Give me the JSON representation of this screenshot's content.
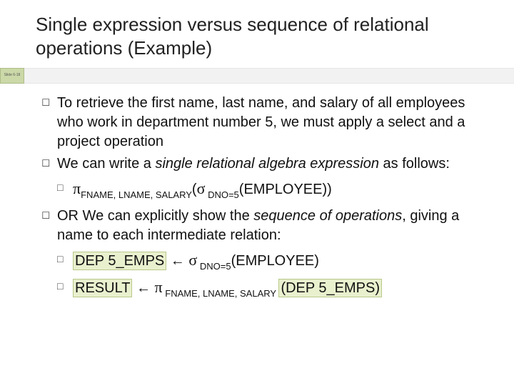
{
  "title": "Single expression versus sequence of relational operations (Example)",
  "slide_tag": "Slide 6-18",
  "bullets": {
    "b1": "To retrieve the first name, last name, and salary of all employees who work in department number 5, we must apply a select and a project operation",
    "b2a": "We can write a ",
    "b2b": "single relational algebra expression",
    "b2c": " as follows:",
    "b3a": "OR We can explicitly show the ",
    "b3b": "sequence of operations",
    "b3c": ", giving a name to each intermediate relation:"
  },
  "expr1": {
    "pi": "π",
    "sub1": "FNAME, LNAME, SALARY",
    "open": "(",
    "sigma": "σ",
    "sub2": " DNO=5",
    "tail": "(EMPLOYEE))"
  },
  "seq1": {
    "name": "DEP 5_EMPS",
    "arrow": " ← ",
    "sigma": "σ",
    "sub": " DNO=5",
    "tail": "(EMPLOYEE)"
  },
  "seq2": {
    "name": "RESULT",
    "arrow": " ← ",
    "pi": "π",
    "sub": " FNAME, LNAME, SALARY ",
    "tail": "(DEP 5_EMPS)"
  }
}
